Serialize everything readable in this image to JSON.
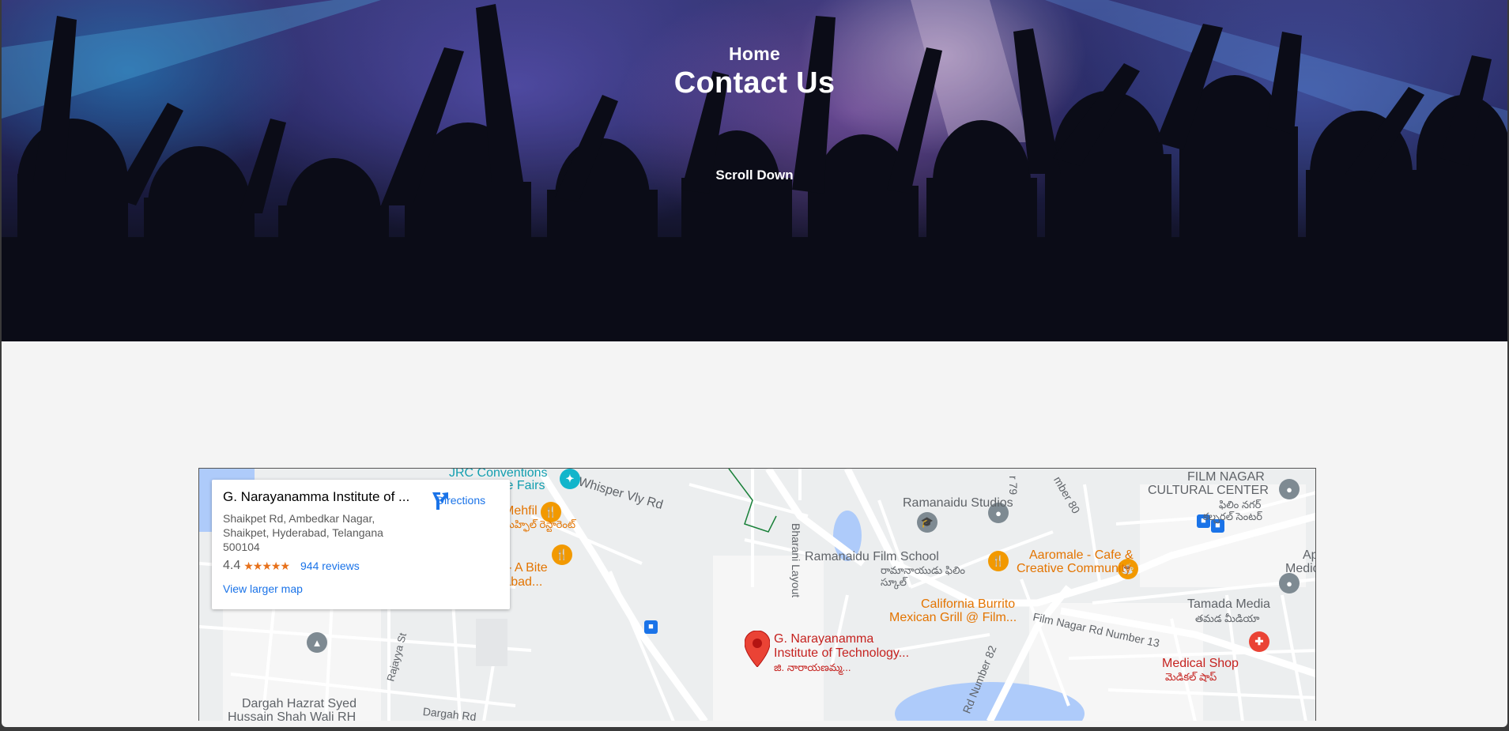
{
  "hero": {
    "breadcrumb": "Home",
    "title": "Contact Us",
    "scroll_label": "Scroll Down"
  },
  "map": {
    "card": {
      "title": "G. Narayanamma Institute of ...",
      "address": "Shaikpet Rd, Ambedkar Nagar, Shaikpet, Hyderabad, Telangana 500104",
      "rating": "4.4",
      "stars": "★★★★★",
      "reviews": "944 reviews",
      "larger_map": "View larger map",
      "directions": "Directions"
    },
    "labels": {
      "jrc": "JRC Conventions",
      "fairs": "le Fairs",
      "whisper": "Whisper Vly Rd",
      "bharani": "Bharani Layout",
      "mehfil": "Mehfil",
      "mehfil_te": "మహ్ఫిల్ రెస్టారెంట్",
      "bite": "- A Bite",
      "bite2": "rabad...",
      "ramanaidu_studios": "Ramanaidu Studios",
      "ramanaidu_school": "Ramanaidu Film School",
      "ramanaidu_school_te": "రామానాయుడు ఫిలిం స్కూల్",
      "film_nagar": "FILM NAGAR",
      "cultural_center": "CULTURAL CENTER",
      "film_nagar_te": "ఫిలిం నగర్",
      "film_nagar_te2": "కల్చరల్ సెంటర్",
      "aaromale": "Aaromale - Cafe &",
      "aaromale2": "Creative Community",
      "california": "California Burrito",
      "california2": "Mexican Grill @ Film...",
      "film_nagar_rd": "Film Nagar Rd Number 13",
      "tamada": "Tamada Media",
      "tamada_te": "తమడ మీడియా",
      "medical": "Medical Shop",
      "medical_te": "మెడికల్ షాప్",
      "medica": "Medica",
      "ap": "Ap",
      "gnits": "G. Narayanamma",
      "gnits2": "Institute of Technology...",
      "gnits_te": "జి. నారాయణమ్మ...",
      "rajayya": "Rajayya St",
      "dargah_rd": "Dargah Rd",
      "dargah": "Dargah Hazrat Syed",
      "dargah2": "Hussain Shah Wali RH",
      "rd82": "Rd Number 82",
      "rd79": "r 79",
      "rd80": "mber 80"
    }
  },
  "colors": {
    "accent_link": "#1a73e8",
    "pin_red": "#ea4335",
    "poi_orange": "#f29900",
    "page_bg": "#f4f4f4"
  }
}
